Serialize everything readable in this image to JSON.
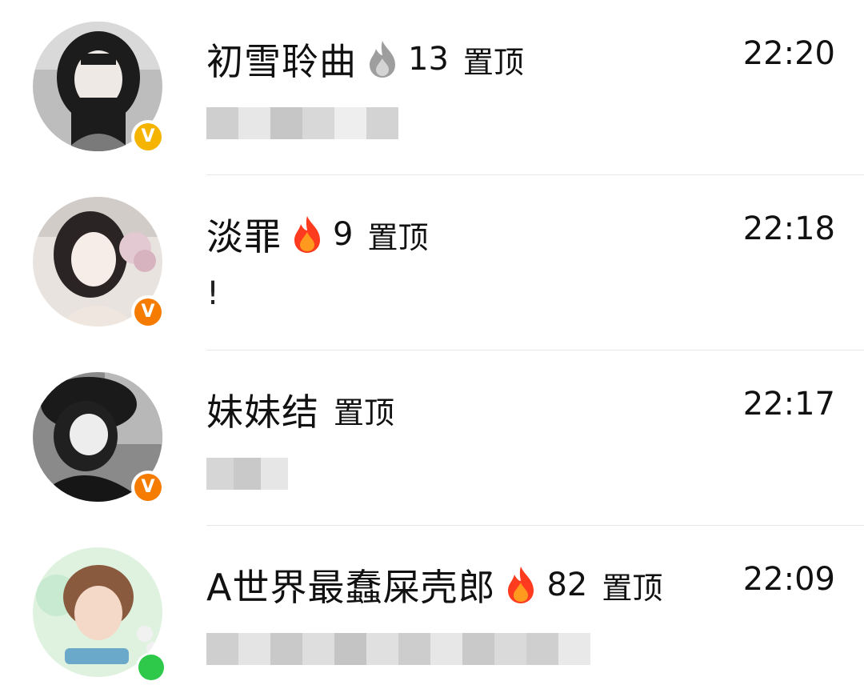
{
  "conversations": [
    {
      "name": "初雪聆曲",
      "streak": "13",
      "flame": "grey-flame-icon",
      "pin": "置顶",
      "time": "22:20",
      "preview": "",
      "badge": "V",
      "badge_color": "#f5b400"
    },
    {
      "name": "淡罪",
      "streak": "9",
      "flame": "fire-icon",
      "pin": "置顶",
      "time": "22:18",
      "preview": "!",
      "badge": "V",
      "badge_color": "#f57c00"
    },
    {
      "name": "妹妹结",
      "streak": "",
      "flame": "",
      "pin": "置顶",
      "time": "22:17",
      "preview": "",
      "badge": "V",
      "badge_color": "#f57c00"
    },
    {
      "name": "A世界最蠢屎壳郎",
      "streak": "82",
      "flame": "fire-icon",
      "pin": "置顶",
      "time": "22:09",
      "preview": "",
      "status": "online",
      "status_color": "#2ec94a"
    }
  ]
}
